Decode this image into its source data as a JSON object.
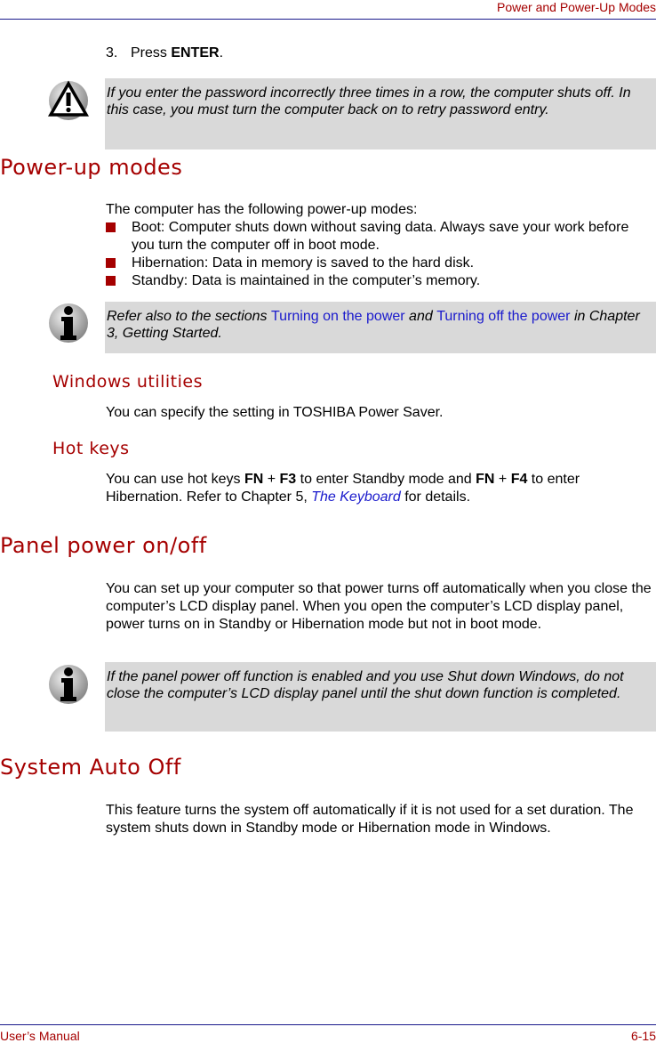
{
  "header": {
    "title": "Power and Power-Up Modes"
  },
  "step": {
    "number": "3.",
    "prefix": "Press ",
    "key": "ENTER",
    "suffix": "."
  },
  "caution_note": {
    "icon": "warning-triangle-icon",
    "text": "If you enter the password incorrectly three times in a row, the computer shuts off. In this case, you must turn the computer back on to retry password entry."
  },
  "power_up_modes": {
    "heading": "Power-up modes",
    "intro": "The computer has the following power-up modes:",
    "items": [
      "Boot: Computer shuts down without saving data. Always save your work before you turn the computer off in boot mode.",
      "Hibernation: Data in memory is saved to the hard disk.",
      "Standby: Data is maintained in the computer’s memory."
    ],
    "note": {
      "icon": "info-icon",
      "text_1": "Refer also to the sections ",
      "link_1": "Turning on the power",
      "text_2": " and ",
      "link_2": "Turning off the power",
      "text_3": " in Chapter 3, Getting Started."
    }
  },
  "windows_utilities": {
    "heading": "Windows utilities",
    "text": "You can specify the setting in TOSHIBA Power Saver."
  },
  "hot_keys": {
    "heading": "Hot keys",
    "t1": "You can use hot keys ",
    "k1": "FN",
    "plus1": " + ",
    "k2": "F3",
    "t2": " to enter Standby mode and ",
    "k3": "FN",
    "plus2": " + ",
    "k4": "F4",
    "t3": " to enter Hibernation. Refer to Chapter 5, ",
    "link": "The Keyboard",
    "t4": " for details."
  },
  "panel_power": {
    "heading": "Panel power on/off",
    "text": "You can set up your computer so that power turns off automatically when you close the computer’s LCD display panel. When you open the computer’s LCD display panel, power turns on in Standby or Hibernation mode but not in boot mode.",
    "note": {
      "icon": "info-icon",
      "text": "If the panel power off function is enabled and you use Shut down Windows, do not close the computer’s LCD display panel until the shut down function is completed."
    }
  },
  "system_auto_off": {
    "heading": "System Auto Off",
    "text": "This feature turns the system off automatically if it is not used for a set duration. The system shuts down in Standby mode or Hibernation mode in Windows."
  },
  "footer": {
    "left": "User’s Manual",
    "right": "6-15"
  }
}
